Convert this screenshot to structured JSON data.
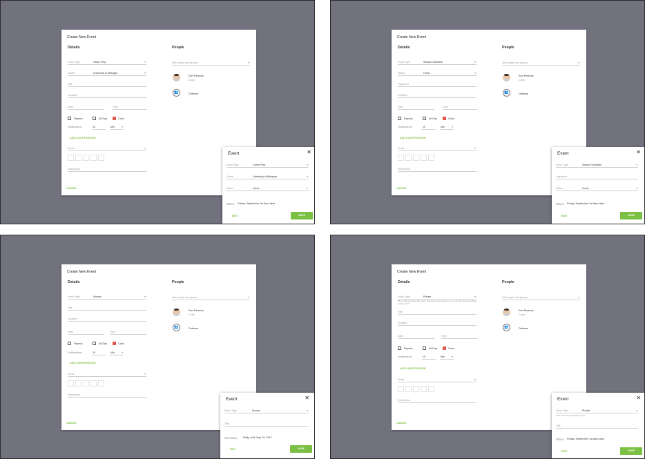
{
  "panels": [
    {
      "dialog": {
        "title": "Create New Event",
        "details_heading": "Details",
        "people_heading": "People",
        "event_type_label": "Event Type",
        "event_type_value": "Game Prep",
        "second_label": "Game",
        "second_value": "University of Michigan",
        "third_label": "Title",
        "location_label": "Location",
        "date_label": "Date",
        "time_label": "Time",
        "repeat_label": "Repeat...",
        "allday_label": "All Day",
        "color_label": "Color",
        "notifications_label": "Notifications",
        "notifications_value": "10",
        "notifications_unit": "Min",
        "add_notification": "ADD A NOTIFICATION",
        "dress_label": "Dress",
        "description_label": "Description",
        "cancel_label": "CANCEL",
        "people_placeholder": "Add people and groups",
        "person_name": "Earl Parsons",
        "person_role": "Coach",
        "group_name": "Defense"
      },
      "popup": {
        "title": "Event",
        "f1_label": "Event Type",
        "f1_value": "Game Prep",
        "f2_label": "Game",
        "f2_value": "University of Michigan",
        "f3_label": "Status",
        "f3_value": "Home",
        "when_label": "When:",
        "when_value": "Friday, September 1st 8am-3pm",
        "edit_label": "EDIT",
        "save_label": "SAVE"
      }
    },
    {
      "dialog": {
        "title": "Create New Event",
        "details_heading": "Details",
        "people_heading": "People",
        "event_type_label": "Event Type",
        "event_type_value": "Season Schedule",
        "second_label": "Status",
        "second_value": "Home",
        "third_label": "Opponent",
        "location_label": "Location",
        "date_label": "Date",
        "time_label": "Time",
        "repeat_label": "Repeat...",
        "allday_label": "All Day",
        "color_label": "Color",
        "notifications_label": "Notifications",
        "notifications_value": "10",
        "notifications_unit": "Min",
        "add_notification": "ADD A NOTIFICATION",
        "dress_label": "Dress",
        "description_label": "Description",
        "cancel_label": "CANCEL",
        "people_placeholder": "Add people and groups",
        "person_name": "Earl Parsons",
        "person_role": "Coach",
        "group_name": "Defense"
      },
      "popup": {
        "title": "Event",
        "f1_label": "Event Type",
        "f1_value": "Season Schedule",
        "f2_label": "Opponent",
        "f3_label": "Status",
        "f3_value": "Home",
        "when_label": "When:",
        "when_value": "Friday, September 1st 8am-3pm",
        "edit_label": "EDIT",
        "save_label": "SAVE"
      }
    },
    {
      "dialog": {
        "title": "Create New Event",
        "details_heading": "Details",
        "people_heading": "People",
        "event_type_label": "Event Type",
        "event_type_value": "Normal",
        "third_label": "Title",
        "location_label": "Location",
        "date_label": "Date",
        "time_label": "Time",
        "repeat_label": "Repeat...",
        "allday_label": "All Day",
        "color_label": "Color",
        "notifications_label": "Notifications",
        "notifications_value": "10",
        "notifications_unit": "Min",
        "add_notification": "ADD A NOTIFICATION",
        "dress_label": "Dress",
        "description_label": "Description",
        "cancel_label": "CANCEL",
        "people_placeholder": "Add people and groups",
        "person_name": "Earl Parsons",
        "person_role": "Coach",
        "group_name": "Defense"
      },
      "popup": {
        "title": "Event",
        "f1_label": "Event Type",
        "f1_value": "Normal",
        "f2_label": "Title",
        "when_label": "Summary:",
        "when_value": "Daily, until Sept 19, 2017",
        "edit_label": "EDIT",
        "save_label": "SAVE"
      }
    },
    {
      "dialog": {
        "title": "Create New Event",
        "details_heading": "Details",
        "people_heading": "People",
        "event_type_label": "Event Type",
        "event_type_value": "Private",
        "private_note": "*By marking private this event will only be viewable by you and who you are adding to this event",
        "third_label": "Title",
        "location_label": "Location",
        "date_label": "Date",
        "time_label": "Time",
        "repeat_label": "Repeat...",
        "allday_label": "All Day",
        "color_label": "Color",
        "notifications_label": "Notifications",
        "notifications_value": "10",
        "notifications_unit": "Min",
        "add_notification": "ADD A NOTIFICATION",
        "dress_label": "Dress",
        "description_label": "Description",
        "cancel_label": "CANCEL",
        "people_placeholder": "Add people and groups",
        "person_name": "Earl Parsons",
        "person_role": "Coach",
        "group_name": "Defense"
      },
      "popup": {
        "title": "Event",
        "f1_label": "Event Type",
        "f1_value": "Private",
        "f1_note": "This event is only shown to you.",
        "f2_label": "Title",
        "when_label": "When:",
        "when_value": "Friday, September 1st 8am-3pm",
        "edit_label": "EDIT",
        "save_label": "SAVE"
      }
    }
  ]
}
